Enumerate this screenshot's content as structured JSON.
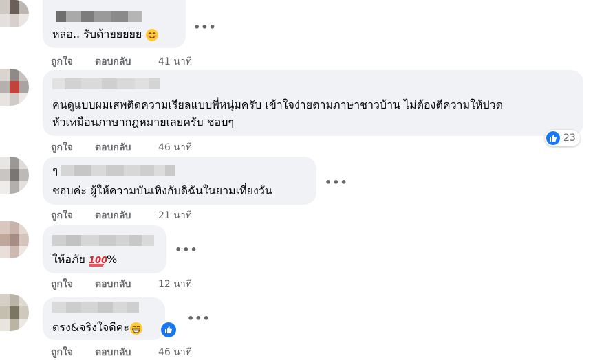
{
  "colors": {
    "accent": "#1877f2",
    "bubble": "#f0f2f5",
    "meta": "#65676b",
    "text": "#050505"
  },
  "comments": [
    {
      "text": "หล่อ.. รับด้ายยยยย",
      "emoji": "smiling-face-emoji",
      "like_label": "ถูกใจ",
      "reply_label": "ตอบกลับ",
      "time": "41 นาที"
    },
    {
      "text_line1": "คนดูแบบผมเสพติดความเรียลแบบพี่หนุ่มครับ เข้าใจง่ายตามภาษาชาวบ้าน ไม่ต้องตีความให้ปวด",
      "text_line2": "หัวเหมือนภาษากฎหมายเลยครับ ชอบๆ",
      "like_label": "ถูกใจ",
      "reply_label": "ตอบกลับ",
      "time": "46 นาที",
      "reaction_count": "23",
      "reaction_icon": "like-icon"
    },
    {
      "name_char": "ๆ",
      "text": "ชอบค่ะ ผู้ให้ความบันเทิงกับดิฉันในยามเที่ยงวัน",
      "like_label": "ถูกใจ",
      "reply_label": "ตอบกลับ",
      "time": "21 นาที"
    },
    {
      "text": "ให้อภัย",
      "emoji": "hundred-points-emoji",
      "suffix": "%",
      "like_label": "ถูกใจ",
      "reply_label": "ตอบกลับ",
      "time": "12 นาที"
    },
    {
      "text": "ตรง&จริงใจดีค่ะ",
      "emoji": "grinning-face-emoji",
      "reaction_icon": "like-icon",
      "like_label": "ถูกใจ",
      "reply_label": "ตอบกลับ",
      "time": "46 นาที"
    }
  ],
  "more_icon": "more-options-icon"
}
